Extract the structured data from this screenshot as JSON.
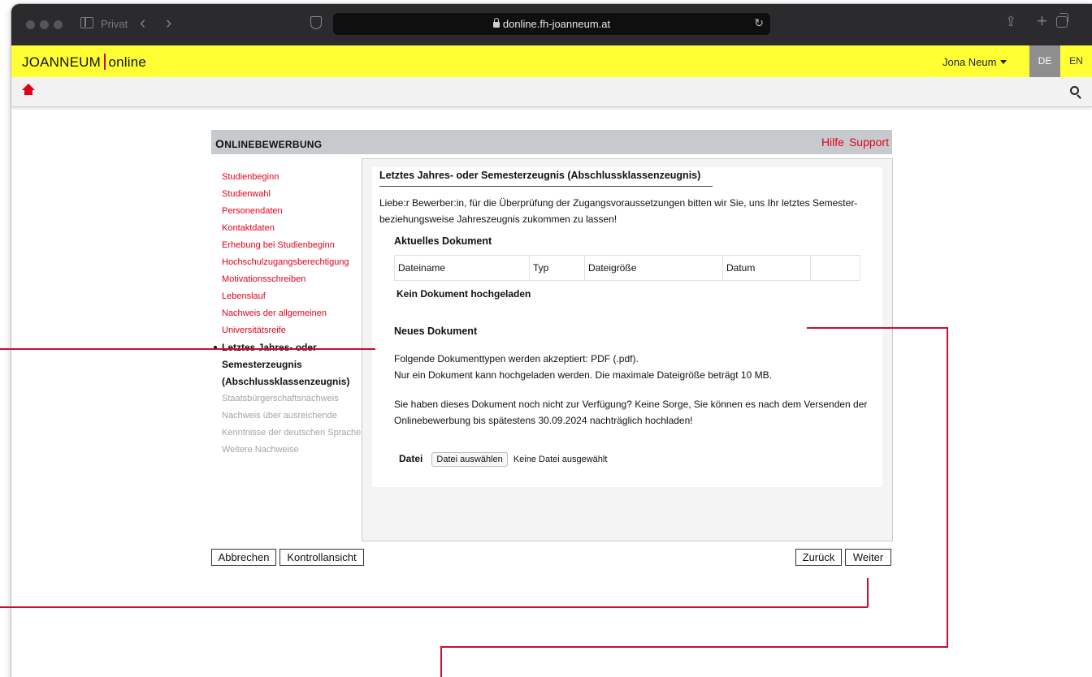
{
  "browser": {
    "private_label": "Privat",
    "url": "donline.fh-joanneum.at"
  },
  "header": {
    "logo_left": "JOANNEUM",
    "logo_right": "online",
    "user_name": "Jona Neum",
    "lang_de": "DE",
    "lang_en": "EN"
  },
  "panel": {
    "title_first": "O",
    "title_rest": "NLINEBEWERBUNG",
    "help_link": "Hilfe",
    "support_link": "Support"
  },
  "sidebar": {
    "items": [
      {
        "label": "Studienbeginn"
      },
      {
        "label": "Studienwahl"
      },
      {
        "label": "Personendaten"
      },
      {
        "label": "Kontaktdaten"
      },
      {
        "label": "Erhebung bei Studienbeginn"
      },
      {
        "label": "Hochschulzugangsberechtigung"
      },
      {
        "label": "Motivationsschreiben"
      },
      {
        "label": "Lebenslauf"
      },
      {
        "label": "Nachweis der allgemeinen"
      },
      {
        "label": "Universitätsreife"
      }
    ],
    "active_lines": [
      "Letztes Jahres- oder",
      "Semesterzeugnis",
      "(Abschlussklassenzeugnis)"
    ],
    "disabled_items": [
      {
        "label": "Staatsbürgerschaftsnachweis"
      },
      {
        "label": "Nachweis über ausreichende"
      },
      {
        "label": "Kenntnisse der deutschen Sprache"
      },
      {
        "label": "Weitere Nachweise"
      }
    ]
  },
  "main": {
    "section_title": "Letztes Jahres- oder Semesterzeugnis (Abschlussklassenzeugnis)",
    "intro_line1": "Liebe:r Bewerber:in, für die Überprüfung der Zugangsvoraussetzungen bitten wir Sie, uns Ihr letztes Semester-",
    "intro_line2": "beziehungsweise Jahreszeugnis zukommen zu lassen!",
    "current_doc_heading": "Aktuelles Dokument",
    "table_headers": [
      "Dateiname",
      "Typ",
      "Dateigröße",
      "Datum",
      ""
    ],
    "no_doc": "Kein Dokument hochgeladen",
    "new_doc_heading": "Neues Dokument",
    "accepted_line1": "Folgende Dokumenttypen werden akzeptiert: PDF (.pdf).",
    "accepted_line2": "Nur ein Dokument kann hochgeladen werden. Die maximale Dateigröße beträgt 10 MB.",
    "later_line1": "Sie haben dieses Dokument noch nicht zur Verfügung? Keine Sorge, Sie können es nach dem Versenden der",
    "later_line2": "Onlinebewerbung bis spätestens 30.09.2024 nachträglich hochladen!",
    "file_label": "Datei",
    "file_button": "Datei auswählen",
    "file_status": "Keine Datei ausgewählt"
  },
  "buttons": {
    "cancel": "Abbrechen",
    "review": "Kontrollansicht",
    "back": "Zurück",
    "next": "Weiter"
  },
  "colors": {
    "accent_red": "#e2001a",
    "header_yellow": "#ffff33",
    "callout_red": "#c8102e"
  }
}
